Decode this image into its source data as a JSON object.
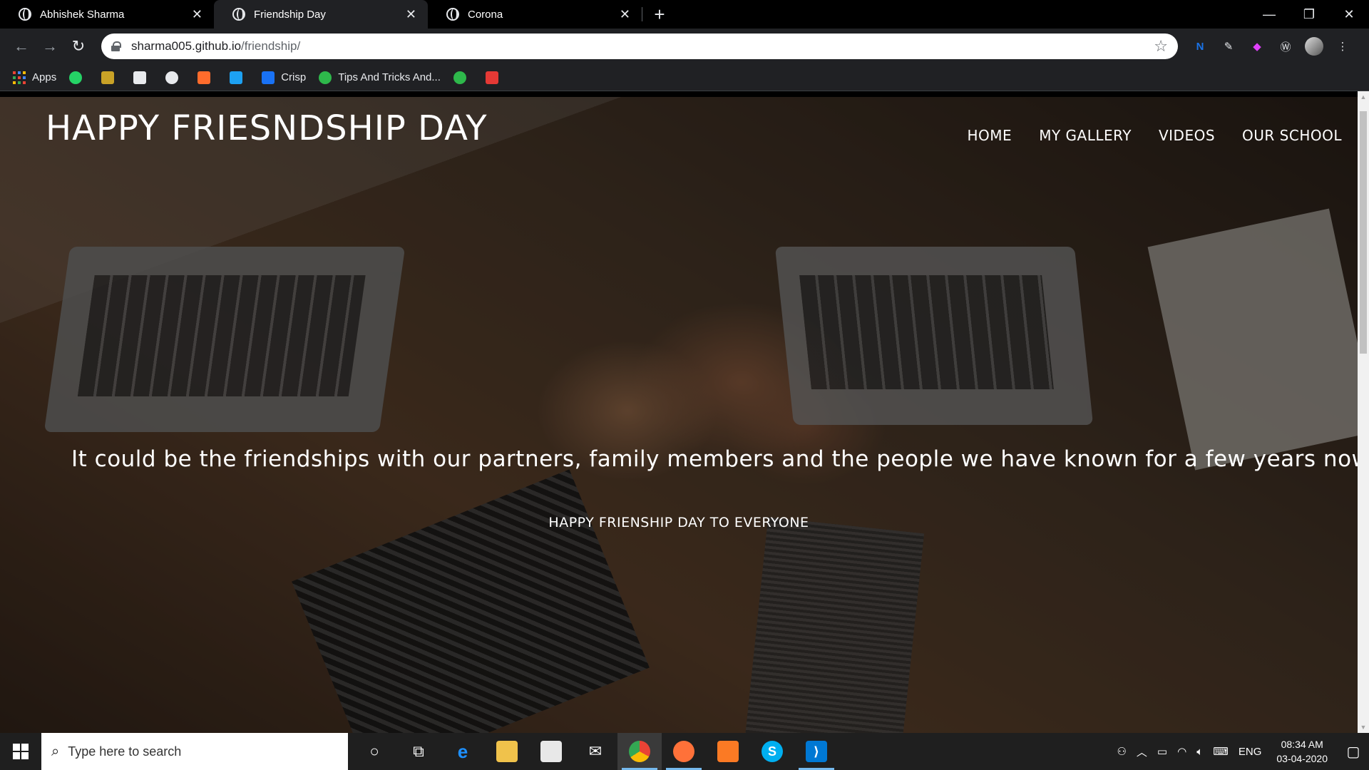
{
  "browser": {
    "tabs": [
      {
        "title": "Abhishek Sharma",
        "close": "✕"
      },
      {
        "title": "Friendship Day",
        "close": "✕"
      },
      {
        "title": "Corona",
        "close": "✕"
      }
    ],
    "new_tab": "+",
    "window": {
      "minimize": "—",
      "restore": "❐",
      "close": "✕"
    },
    "url": {
      "host": "sharma005.github.io",
      "path": "/friendship/"
    },
    "bookmarks": {
      "apps": "Apps",
      "crisp": "Crisp",
      "tips": "Tips And Tricks And..."
    }
  },
  "page": {
    "site_title": "HAPPY FRIESNDSHIP DAY",
    "nav": [
      "HOME",
      "MY GALLERY",
      "VIDEOS",
      "OUR SCHOOL"
    ],
    "marquee": "It could be the friendships with our partners, family members and the people we have known for a few years now or",
    "tagline": "HAPPY FRIENSHIP DAY TO EVERYONE"
  },
  "taskbar": {
    "search_placeholder": "Type here to search",
    "language": "ENG",
    "time": "08:34 AM",
    "date": "03-04-2020"
  },
  "colors": {
    "chrome_bg": "#202124",
    "taskbar_bg": "#1f1f1f",
    "accent": "#76b9ed"
  }
}
